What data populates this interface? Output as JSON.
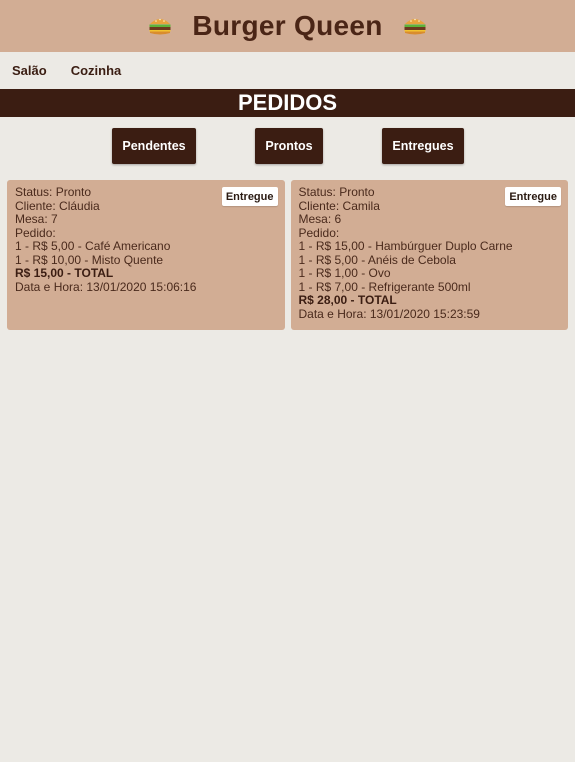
{
  "header": {
    "title": "Burger Queen",
    "icon": "burger-icon"
  },
  "nav": {
    "items": [
      "Salão",
      "Cozinha"
    ]
  },
  "section_title": "PEDIDOS",
  "tabs": [
    "Pendentes",
    "Prontos",
    "Entregues"
  ],
  "colors": {
    "header_bg": "#D2AD94",
    "dark_brown": "#3B1D12",
    "page_bg": "#ECEAE5",
    "card_bg": "#D2AD94"
  },
  "orders": [
    {
      "status": "Status: Pronto",
      "client": "Cliente: Cláudia",
      "table": "Mesa: 7",
      "order_label": "Pedido:",
      "items": [
        "1 - R$ 5,00 - Café Americano",
        "1 - R$ 10,00 - Misto Quente"
      ],
      "total": "R$ 15,00 - TOTAL",
      "datetime": "Data e Hora: 13/01/2020 15:06:16",
      "action": "Entregue"
    },
    {
      "status": "Status: Pronto",
      "client": "Cliente: Camila",
      "table": "Mesa: 6",
      "order_label": "Pedido:",
      "items": [
        "1 - R$ 15,00 - Hambúrguer Duplo Carne",
        "1 - R$ 5,00 - Anéis de Cebola",
        "1 - R$ 1,00 - Ovo",
        "1 - R$ 7,00 - Refrigerante 500ml"
      ],
      "total": "R$ 28,00 - TOTAL",
      "datetime": "Data e Hora: 13/01/2020 15:23:59",
      "action": "Entregue"
    }
  ]
}
